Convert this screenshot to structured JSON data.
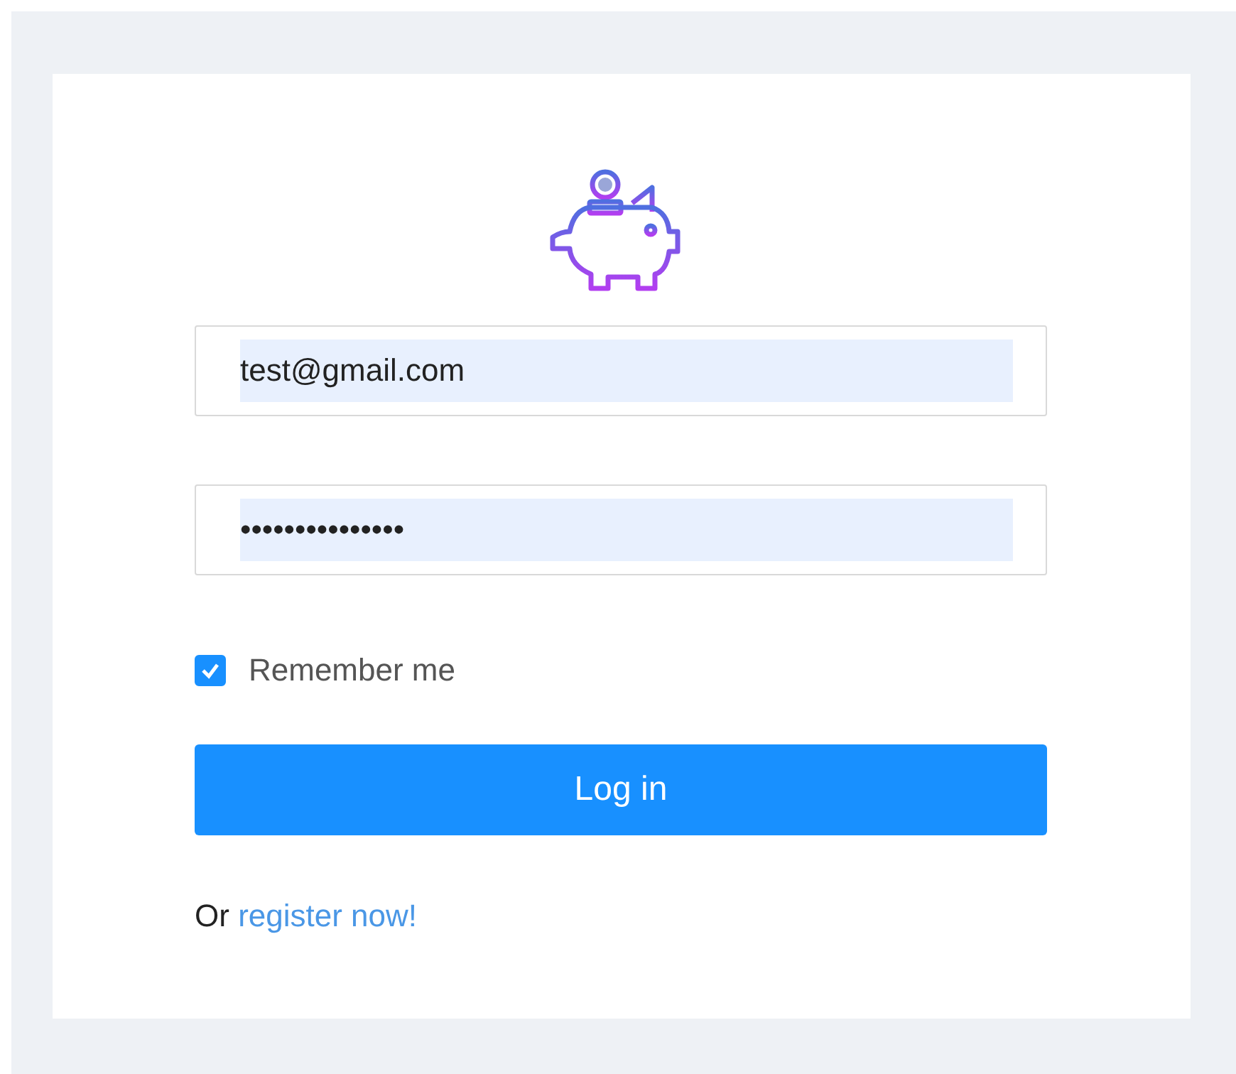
{
  "form": {
    "email": {
      "value": "test@gmail.com"
    },
    "password": {
      "value": "•••••••••••••••"
    },
    "remember": {
      "label": "Remember me",
      "checked": true
    },
    "submit": {
      "label": "Log in"
    },
    "register": {
      "prefix": "Or",
      "link": "register now!"
    }
  }
}
